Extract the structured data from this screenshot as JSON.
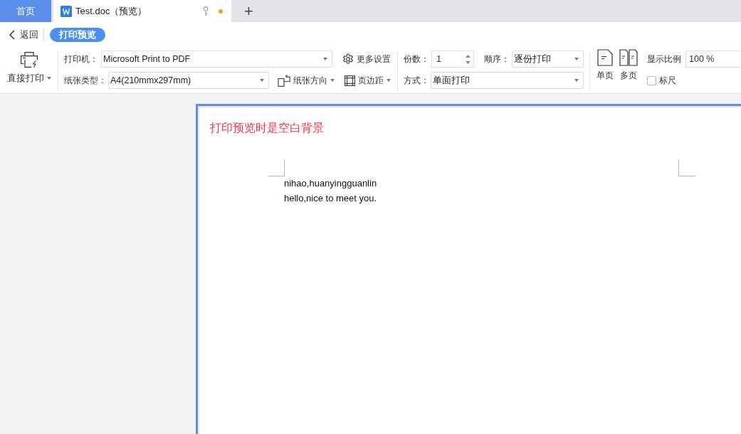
{
  "tabs": [
    {
      "kind": "home",
      "label": "首页",
      "selected": false
    },
    {
      "kind": "document",
      "label": "Test.doc（预览）",
      "selected": true,
      "unsaved": true
    }
  ],
  "new_tab": "+",
  "nav": {
    "back": "返回",
    "mode": "打印预览"
  },
  "toolbar": {
    "print_button": "直接打印",
    "printer": {
      "label": "打印机：",
      "value": "Microsoft Print to PDF"
    },
    "more_settings": "更多设置",
    "copies": {
      "label": "份数：",
      "value": "1"
    },
    "order": {
      "label": "顺序：",
      "value": "逐份打印"
    },
    "paper": {
      "label": "纸张类型：",
      "value": "A4(210mmx297mm)"
    },
    "orientation": "纸张方向",
    "margins": "页边距",
    "duplex": {
      "label": "方式：",
      "value": "单面打印"
    },
    "view_buttons": [
      {
        "kind": "single",
        "label": "单页"
      },
      {
        "kind": "multi",
        "label": "多页"
      }
    ],
    "zoom": {
      "label": "显示比例",
      "value": "100 %"
    },
    "ruler": {
      "label": "标尺",
      "checked": false
    }
  },
  "page": {
    "selected": true,
    "annotation": "打印预览时是空白背景",
    "lines": [
      "nihao,huanyingguanlin",
      "hello,nice to meet you."
    ]
  }
}
